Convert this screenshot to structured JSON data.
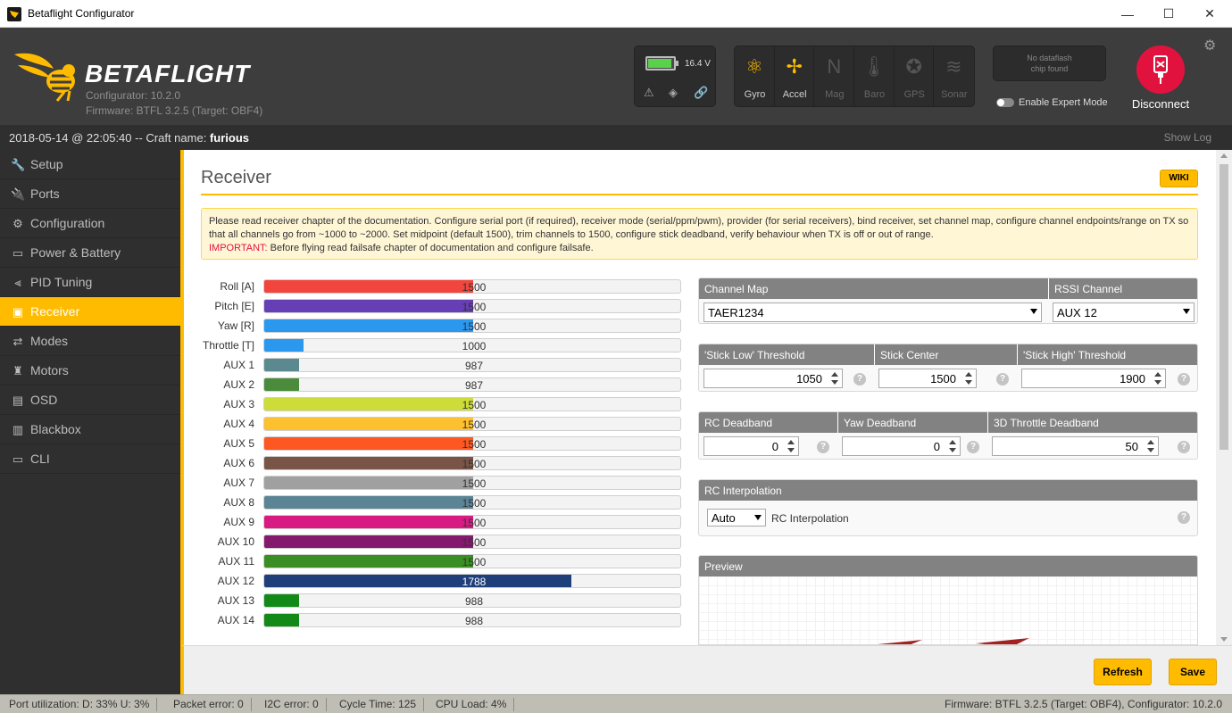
{
  "window": {
    "title": "Betaflight Configurator",
    "minimize_glyph": "—",
    "maximize_glyph": "☐",
    "close_glyph": "✕"
  },
  "header": {
    "logo_text": "BETAFLIGHT",
    "configurator_version": "Configurator: 10.2.0",
    "firmware_info": "Firmware: BTFL 3.2.5 (Target: OBF4)",
    "battery": {
      "voltage": "16.4 V",
      "level": 0.85,
      "fill_color": "#59d14a"
    },
    "battery_icons": {
      "warning": "⚠",
      "diamond": "◈",
      "link": "🔗"
    },
    "sensors": [
      {
        "label": "Gyro",
        "glyph": "⚛",
        "active": true
      },
      {
        "label": "Accel",
        "glyph": "✢",
        "active": true
      },
      {
        "label": "Mag",
        "glyph": "N",
        "active": false
      },
      {
        "label": "Baro",
        "glyph": "🌡",
        "active": false
      },
      {
        "label": "GPS",
        "glyph": "✪",
        "active": false
      },
      {
        "label": "Sonar",
        "glyph": "≋",
        "active": false
      }
    ],
    "dataflash_line1": "No dataflash",
    "dataflash_line2": "chip found",
    "expert_mode_label": "Enable Expert Mode",
    "expert_mode_enabled": false,
    "disconnect_label": "Disconnect",
    "settings_glyph": "⚙"
  },
  "status_top": {
    "datetime": "2018-05-14 @ 22:05:40 -- Craft name:",
    "craft_name": "furious",
    "show_log": "Show Log"
  },
  "sidebar": {
    "items": [
      {
        "label": "Setup",
        "glyph": "🔧",
        "active": false
      },
      {
        "label": "Ports",
        "glyph": "🔌",
        "active": false
      },
      {
        "label": "Configuration",
        "glyph": "⚙",
        "active": false
      },
      {
        "label": "Power & Battery",
        "glyph": "▭",
        "active": false
      },
      {
        "label": "PID Tuning",
        "glyph": "⫷",
        "active": false
      },
      {
        "label": "Receiver",
        "glyph": "▣",
        "active": true
      },
      {
        "label": "Modes",
        "glyph": "⇄",
        "active": false
      },
      {
        "label": "Motors",
        "glyph": "♜",
        "active": false
      },
      {
        "label": "OSD",
        "glyph": "▤",
        "active": false
      },
      {
        "label": "Blackbox",
        "glyph": "▥",
        "active": false
      },
      {
        "label": "CLI",
        "glyph": "▭",
        "active": false
      }
    ]
  },
  "page": {
    "title": "Receiver",
    "wiki_label": "WIKI",
    "note_text": "Please read receiver chapter of the documentation. Configure serial port (if required), receiver mode (serial/ppm/pwm), provider (for serial receivers), bind receiver, set channel map, configure channel endpoints/range on TX so that all channels go from ~1000 to ~2000. Set midpoint (default 1500), trim channels to 1500, configure stick deadband, verify behaviour when TX is off or out of range.",
    "note_important_label": "IMPORTANT:",
    "note_important_text": " Before flying read failsafe chapter of documentation and configure failsafe."
  },
  "channels": {
    "range": [
      885,
      2115
    ],
    "items": [
      {
        "label": "Roll [A]",
        "value": 1500,
        "color": "#f1453d"
      },
      {
        "label": "Pitch [E]",
        "value": 1500,
        "color": "#673fb4"
      },
      {
        "label": "Yaw [R]",
        "value": 1500,
        "color": "#2b98f0"
      },
      {
        "label": "Throttle [T]",
        "value": 1000,
        "color": "#2b98f0"
      },
      {
        "label": "AUX 1",
        "value": 987,
        "color": "#5a8a90"
      },
      {
        "label": "AUX 2",
        "value": 987,
        "color": "#4a8c3c"
      },
      {
        "label": "AUX 3",
        "value": 1500,
        "color": "#cddc39"
      },
      {
        "label": "AUX 4",
        "value": 1500,
        "color": "#fdc02f"
      },
      {
        "label": "AUX 5",
        "value": 1500,
        "color": "#fd5722"
      },
      {
        "label": "AUX 6",
        "value": 1500,
        "color": "#795548"
      },
      {
        "label": "AUX 7",
        "value": 1500,
        "color": "#a0a0a0"
      },
      {
        "label": "AUX 8",
        "value": 1500,
        "color": "#5b8495"
      },
      {
        "label": "AUX 9",
        "value": 1500,
        "color": "#d81b82"
      },
      {
        "label": "AUX 10",
        "value": 1500,
        "color": "#831a6e"
      },
      {
        "label": "AUX 11",
        "value": 1500,
        "color": "#3b8e23"
      },
      {
        "label": "AUX 12",
        "value": 1788,
        "color": "#1f3f7a"
      },
      {
        "label": "AUX 13",
        "value": 988,
        "color": "#138a18"
      },
      {
        "label": "AUX 14",
        "value": 988,
        "color": "#138a18"
      }
    ]
  },
  "channel_map": {
    "label": "Channel Map",
    "value": "TAER1234"
  },
  "rssi": {
    "label": "RSSI Channel",
    "value": "AUX 12"
  },
  "thresholds": {
    "low_label": "'Stick Low' Threshold",
    "low_value": "1050",
    "center_label": "Stick Center",
    "center_value": "1500",
    "high_label": "'Stick High' Threshold",
    "high_value": "1900"
  },
  "deadbands": {
    "rc_label": "RC Deadband",
    "rc_value": "0",
    "yaw_label": "Yaw Deadband",
    "yaw_value": "0",
    "throttle3d_label": "3D Throttle Deadband",
    "throttle3d_value": "50"
  },
  "interpolation": {
    "title": "RC Interpolation",
    "value": "Auto",
    "label": "RC Interpolation"
  },
  "preview": {
    "title": "Preview"
  },
  "help_glyph": "?",
  "toolbar": {
    "refresh_label": "Refresh",
    "save_label": "Save"
  },
  "status_bottom": {
    "port_util": "Port utilization: D: 33% U: 3%",
    "packet_error": "Packet error: 0",
    "i2c_error": "I2C error: 0",
    "cycle_time": "Cycle Time: 125",
    "cpu_load": "CPU Load: 4%",
    "firmware": "Firmware: BTFL 3.2.5 (Target: OBF4), Configurator: 10.2.0"
  }
}
